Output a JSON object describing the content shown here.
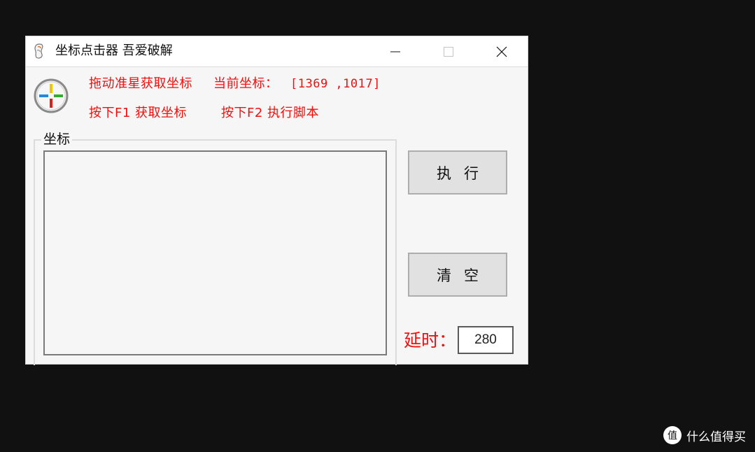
{
  "window": {
    "title": "坐标点击器  吾爱破解",
    "controls": {
      "minimize": "minimize",
      "maximize": "maximize",
      "close": "close"
    }
  },
  "header": {
    "drag_hint": "拖动准星获取坐标",
    "current_coord_label": "当前坐标：",
    "current_coord_value": "[1369 ,1017]",
    "f1_hint": "按下F1 获取坐标",
    "f2_hint": "按下F2  执行脚本"
  },
  "group": {
    "label": "坐标",
    "items": []
  },
  "buttons": {
    "execute": "执行",
    "clear": "清空"
  },
  "delay": {
    "label": "延时：",
    "value": "280"
  },
  "watermark": {
    "text": "什么值得买",
    "icon_glyph": "值"
  },
  "colors": {
    "accent_red": "#f01010",
    "background": "#111111",
    "window_bg": "#f6f6f6"
  },
  "icons": [
    "app-icon",
    "crosshair-icon",
    "minimize-icon",
    "maximize-icon",
    "close-icon",
    "watermark-logo-icon"
  ]
}
